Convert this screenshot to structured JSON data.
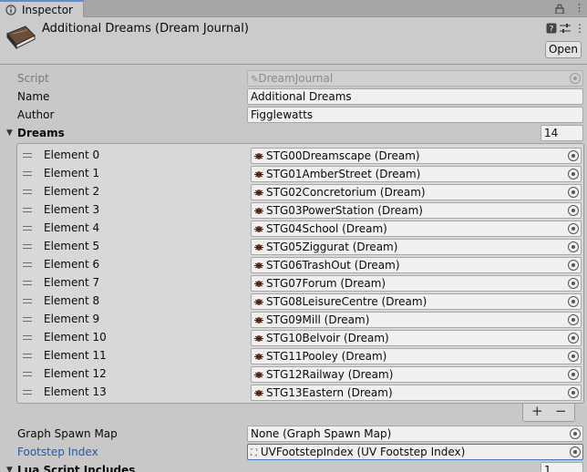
{
  "tab": {
    "label": "Inspector",
    "icon": "info-icon"
  },
  "header": {
    "title": "Additional Dreams (Dream Journal)",
    "icon": "book-icon",
    "open_label": "Open"
  },
  "fields": {
    "script": {
      "label": "Script",
      "value": "DreamJournal"
    },
    "name": {
      "label": "Name",
      "value": "Additional Dreams"
    },
    "author": {
      "label": "Author",
      "value": "Figglewatts"
    }
  },
  "dreams": {
    "label": "Dreams",
    "size": "14",
    "elements": [
      {
        "label": "Element 0",
        "value": "STG00Dreamscape (Dream)"
      },
      {
        "label": "Element 1",
        "value": "STG01AmberStreet (Dream)"
      },
      {
        "label": "Element 2",
        "value": "STG02Concretorium (Dream)"
      },
      {
        "label": "Element 3",
        "value": "STG03PowerStation (Dream)"
      },
      {
        "label": "Element 4",
        "value": "STG04School (Dream)"
      },
      {
        "label": "Element 5",
        "value": "STG05Ziggurat (Dream)"
      },
      {
        "label": "Element 6",
        "value": "STG06TrashOut (Dream)"
      },
      {
        "label": "Element 7",
        "value": "STG07Forum (Dream)"
      },
      {
        "label": "Element 8",
        "value": "STG08LeisureCentre (Dream)"
      },
      {
        "label": "Element 9",
        "value": "STG09Mill (Dream)"
      },
      {
        "label": "Element 10",
        "value": "STG10Belvoir (Dream)"
      },
      {
        "label": "Element 11",
        "value": "STG11Pooley (Dream)"
      },
      {
        "label": "Element 12",
        "value": "STG12Railway (Dream)"
      },
      {
        "label": "Element 13",
        "value": "STG13Eastern (Dream)"
      }
    ],
    "add_label": "+",
    "remove_label": "−"
  },
  "graph_spawn_map": {
    "label": "Graph Spawn Map",
    "value": "None (Graph Spawn Map)"
  },
  "footstep_index": {
    "label": "Footstep Index",
    "value": "UVFootstepIndex (UV Footstep Index)"
  },
  "lua_script_includes": {
    "label": "Lua Script Includes",
    "size": "1"
  },
  "colors": {
    "accent": "#1f58b4",
    "panel": "#c8c8c8"
  }
}
